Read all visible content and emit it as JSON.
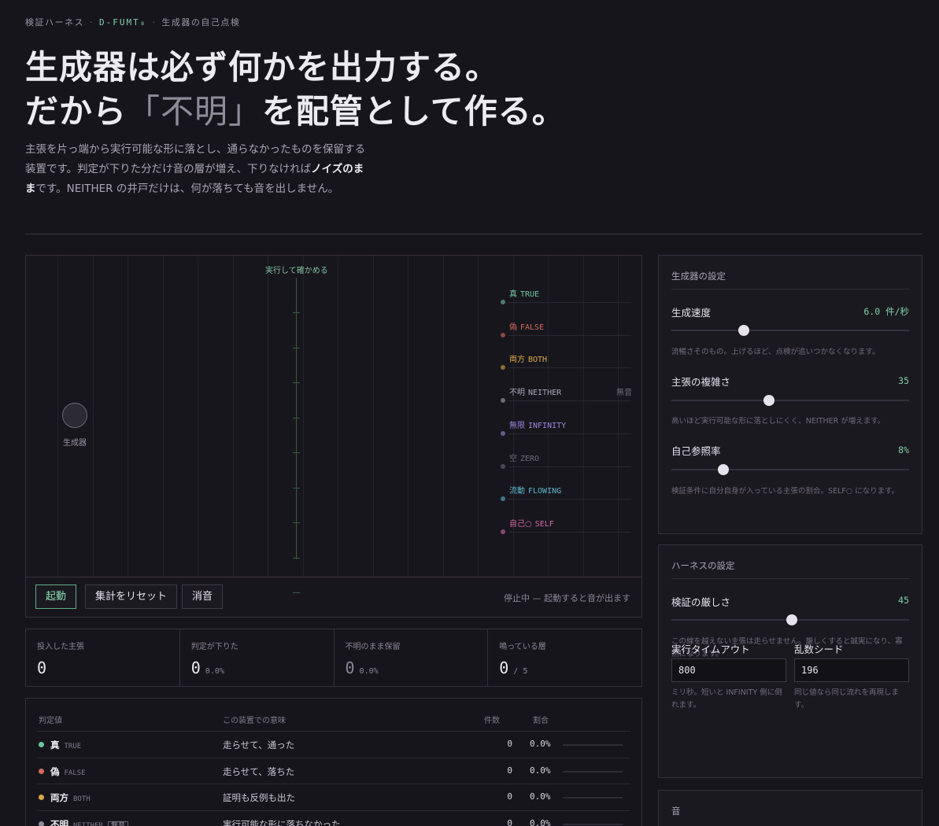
{
  "breadcrumb": {
    "part1": "検証ハーネス",
    "sep": "·",
    "part2": "D-FUMT₈",
    "part3": "生成器の自己点検"
  },
  "title": {
    "line1": "生成器は必ず何かを出力する。",
    "line2a": "だから",
    "line2b": "「不明」",
    "line2c": "を配管として作る。"
  },
  "lede": {
    "a": "主張を片っ端から実行可能な形に落とし、通らなかったものを保留する装置です。判定が下りた分だけ音の層が増え、下りなければ",
    "b": "ノイズのまま",
    "c": "です。NEITHER の井戸だけは、何が落ちても音を出しません。"
  },
  "stage": {
    "verify_label": "実行して確かめる",
    "generator_label": "生成器",
    "lanes": [
      {
        "jp": "真",
        "en": "TRUE",
        "color": "#6fc79e"
      },
      {
        "jp": "偽",
        "en": "FALSE",
        "color": "#d46a5a"
      },
      {
        "jp": "両方",
        "en": "BOTH",
        "color": "#d9a94a"
      },
      {
        "jp": "不明",
        "en": "NEITHER",
        "color": "#a9a5b4",
        "mute": "無音"
      },
      {
        "jp": "無限",
        "en": "INFINITY",
        "color": "#9a88d8"
      },
      {
        "jp": "空",
        "en": "ZERO",
        "color": "#6f6b7b"
      },
      {
        "jp": "流動",
        "en": "FLOWING",
        "color": "#5bb6cc"
      },
      {
        "jp": "自己○",
        "en": "SELF",
        "color": "#d46aa8"
      }
    ],
    "buttons": {
      "start": "起動",
      "reset": "集計をリセット",
      "mute": "消音"
    },
    "status": "停止中 — 起動すると音が出ます"
  },
  "stats": [
    {
      "label": "投入した主張",
      "value": "0",
      "sub": ""
    },
    {
      "label": "判定が下りた",
      "value": "0",
      "sub": "0.0%"
    },
    {
      "label": "不明のまま保留",
      "value": "0",
      "sub": "0.0%"
    },
    {
      "label": "鳴っている層",
      "value": "0",
      "sub": "/ 5"
    }
  ],
  "table": {
    "headers": {
      "value": "判定値",
      "meaning": "この装置での意味",
      "count": "件数",
      "ratio": "割合"
    },
    "rows": [
      {
        "jp": "真",
        "en": "TRUE",
        "color": "#6fc79e",
        "meaning": "走らせて、通った",
        "count": "0",
        "ratio": "0.0%"
      },
      {
        "jp": "偽",
        "en": "FALSE",
        "color": "#d46a5a",
        "meaning": "走らせて、落ちた",
        "count": "0",
        "ratio": "0.0%"
      },
      {
        "jp": "両方",
        "en": "BOTH",
        "color": "#d9a94a",
        "meaning": "証明も反例も出た",
        "count": "0",
        "ratio": "0.0%"
      },
      {
        "jp": "不明",
        "en": "NEITHER",
        "color": "#8f8c9a",
        "badge": "無音",
        "meaning": "実行可能な形に落ちなかった",
        "count": "0",
        "ratio": "0.0%"
      }
    ]
  },
  "generator_panel": {
    "title": "生成器の設定",
    "speed": {
      "name": "生成速度",
      "value": "6.0 件/秒",
      "fraction": 0.24,
      "help": "流暢さそのもの。上げるほど、点検が追いつかなくなります。"
    },
    "complexity": {
      "name": "主張の複雑さ",
      "value": "35",
      "fraction": 0.35,
      "help": "高いほど実行可能な形に落としにくく、NEITHER が増えます。"
    },
    "selfref": {
      "name": "自己参照率",
      "value": "8%",
      "fraction": 0.15,
      "help": "検証条件に自分自身が入っている主張の割合。SELF○ になります。"
    }
  },
  "harness_panel": {
    "title": "ハーネスの設定",
    "strict": {
      "name": "検証の厳しさ",
      "value": "45",
      "fraction": 0.45,
      "help": "この線を越えない主張は走らせません。厳しくすると誠実になり、寡黙になります。"
    },
    "timeout": {
      "name": "実行タイムアウト",
      "value": "800",
      "help": "ミリ秒。短いと INFINITY 側に倒れます。"
    },
    "seed": {
      "name": "乱数シード",
      "value": "196",
      "help": "同じ値なら同じ流れを再現します。"
    }
  },
  "sound_panel": {
    "title": "音"
  }
}
